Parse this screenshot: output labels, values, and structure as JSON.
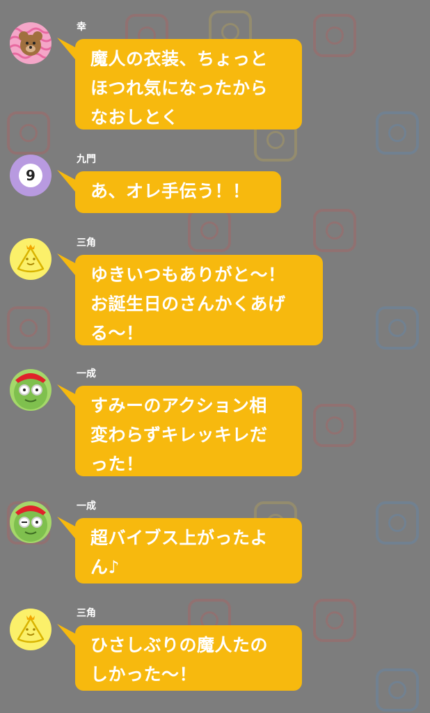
{
  "messages": [
    {
      "sender": "幸",
      "avatar": "bear-avatar-icon",
      "text": "魔人の衣装、ちょっと\nほつれ気になったから\nなおしとく"
    },
    {
      "sender": "九門",
      "avatar": "number-nine-avatar-icon",
      "avatar_text": "9",
      "text": "あ、オレ手伝う！！"
    },
    {
      "sender": "三角",
      "avatar": "triangle-character-avatar-icon",
      "text": "ゆきいつもありがと〜！\nお誕生日のさんかくあげ\nる〜！"
    },
    {
      "sender": "一成",
      "avatar": "green-face-avatar-icon",
      "text": "すみーのアクション相\n変わらずキレッキレだ\nった！"
    },
    {
      "sender": "一成",
      "avatar": "green-face-avatar-icon",
      "text": "超バイブス上がったよ\nん♪"
    },
    {
      "sender": "三角",
      "avatar": "triangle-character-avatar-icon",
      "text": "ひさしぶりの魔人たの\nしかった〜！"
    }
  ],
  "colors": {
    "background": "#7d7d7d",
    "bubble": "#f7b90e",
    "text": "#ffffff"
  }
}
